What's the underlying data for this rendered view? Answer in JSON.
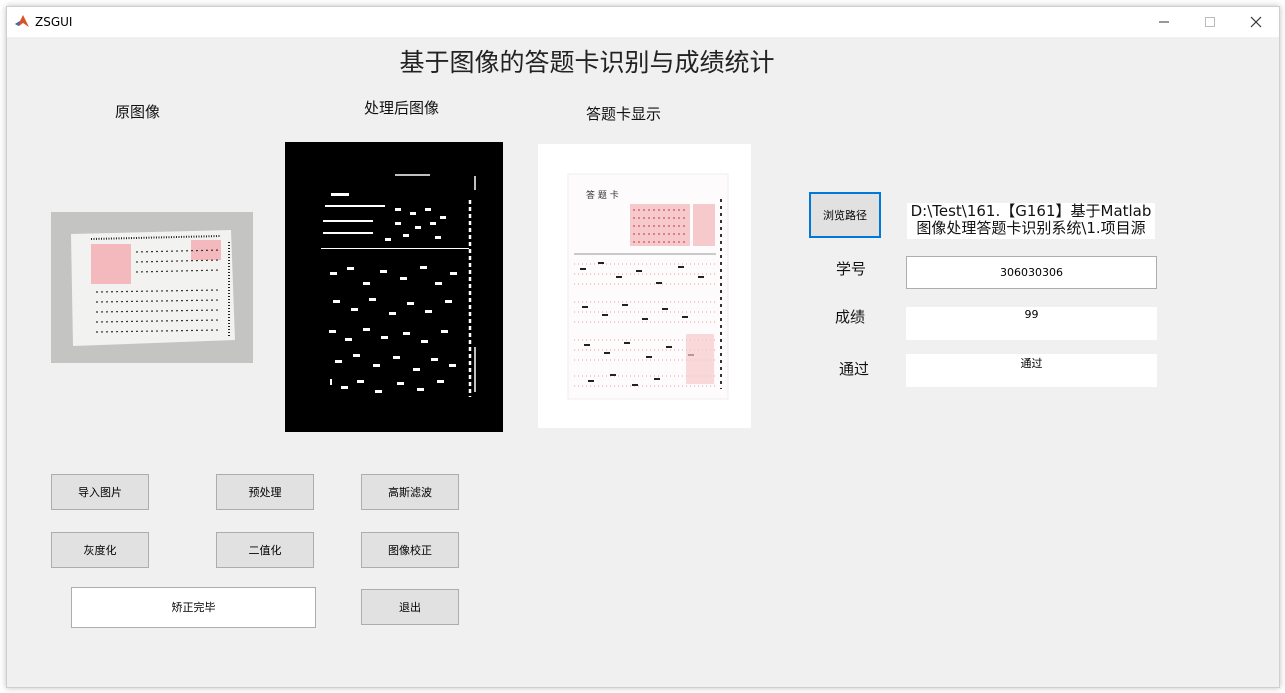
{
  "window": {
    "title": "ZSGUI"
  },
  "header": {
    "title": "基于图像的答题卡识别与成绩统计"
  },
  "panels": {
    "original_label": "原图像",
    "processed_label": "处理后图像",
    "answer_card_label": "答题卡显示"
  },
  "right": {
    "browse_label": "浏览路径",
    "path_line1": "D:\\Test\\161.【G161】基于Matlab",
    "path_line2": "图像处理答题卡识别系统\\1.项目源",
    "student_id_label": "学号",
    "student_id_value": "306030306",
    "score_label": "成绩",
    "score_value": "99",
    "pass_label": "通过",
    "pass_value": "通过"
  },
  "buttons": {
    "import": "导入图片",
    "preprocess": "预处理",
    "gaussian": "高斯滤波",
    "grayscale": "灰度化",
    "binarize": "二值化",
    "correct": "图像校正",
    "exit": "退出"
  },
  "status": {
    "text": "矫正完毕"
  },
  "icons": [
    "matlab-icon",
    "minimize-icon",
    "maximize-icon",
    "close-icon"
  ]
}
